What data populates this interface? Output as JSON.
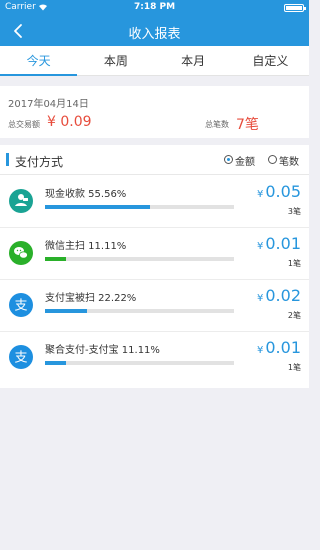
{
  "status": {
    "carrier": "Carrier",
    "time": "7:18 PM"
  },
  "nav": {
    "title": "收入报表"
  },
  "tabs": [
    {
      "label": "今天",
      "active": true
    },
    {
      "label": "本周",
      "active": false
    },
    {
      "label": "本月",
      "active": false
    },
    {
      "label": "自定义",
      "active": false
    }
  ],
  "summary": {
    "date": "2017年04月14日",
    "total_amount_label": "总交易额",
    "total_amount": "¥ 0.09",
    "total_count_label": "总笔数",
    "total_count": "7笔"
  },
  "payment": {
    "title": "支付方式",
    "options": {
      "amount": "金额",
      "count": "笔数",
      "selected": "amount"
    },
    "methods": [
      {
        "icon": "cash-icon",
        "name": "现金收款 55.56%",
        "percent": 55.56,
        "currency": "¥",
        "amount": "0.05",
        "count": "3笔",
        "color": "#1aa394",
        "bar_color": "#2796dd"
      },
      {
        "icon": "wechat-icon",
        "name": "微信主扫 11.11%",
        "percent": 11.11,
        "currency": "¥",
        "amount": "0.01",
        "count": "1笔",
        "color": "#2ab02a",
        "bar_color": "#2ab02a"
      },
      {
        "icon": "alipay-icon",
        "name": "支付宝被扫 22.22%",
        "percent": 22.22,
        "currency": "¥",
        "amount": "0.02",
        "count": "2笔",
        "color": "#1d8fe0",
        "bar_color": "#2796dd"
      },
      {
        "icon": "alipay-icon",
        "name": "聚合支付-支付宝 11.11%",
        "percent": 11.11,
        "currency": "¥",
        "amount": "0.01",
        "count": "1笔",
        "color": "#1d8fe0",
        "bar_color": "#2796dd"
      }
    ]
  }
}
